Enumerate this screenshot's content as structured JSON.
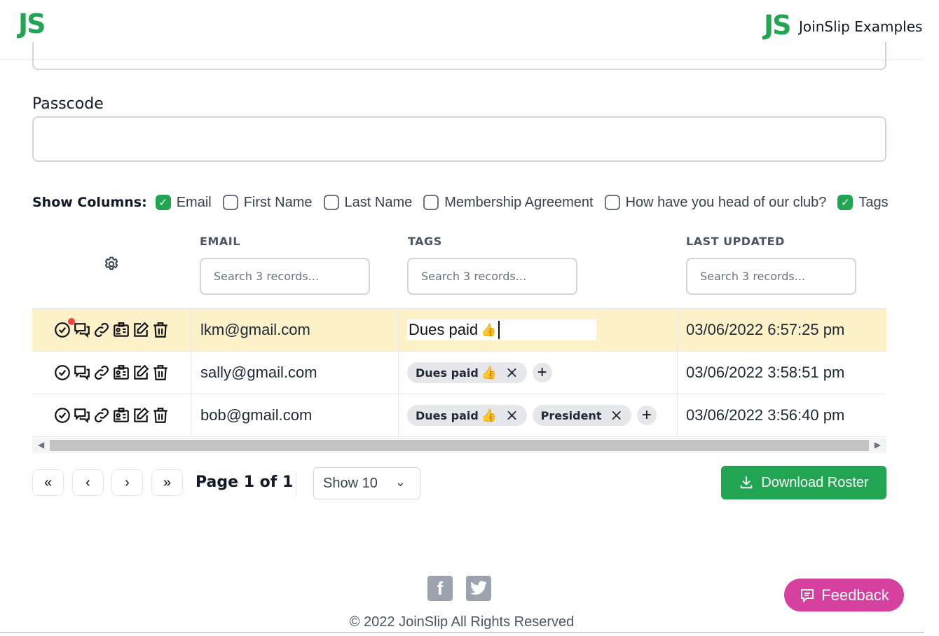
{
  "header": {
    "logo_left": "JS",
    "logo_right": "JS",
    "brand": "JoinSlip Examples"
  },
  "form": {
    "passcode_label": "Passcode",
    "passcode_value": ""
  },
  "show_columns": {
    "label": "Show Columns:",
    "options": [
      {
        "label": "Email",
        "checked": true
      },
      {
        "label": "First Name",
        "checked": false
      },
      {
        "label": "Last Name",
        "checked": false
      },
      {
        "label": "Membership Agreement",
        "checked": false
      },
      {
        "label": "How have you head of our club?",
        "checked": false
      },
      {
        "label": "Tags",
        "checked": true
      }
    ]
  },
  "table": {
    "headers": {
      "email": "EMAIL",
      "tags": "TAGS",
      "last_updated": "LAST UPDATED"
    },
    "search_placeholder": "Search 3 records...",
    "rows": [
      {
        "email": "lkm@gmail.com",
        "tags_editing": "Dues paid",
        "updated": "03/06/2022 6:57:25 pm"
      },
      {
        "email": "sally@gmail.com",
        "tags": [
          "Dues paid"
        ],
        "updated": "03/06/2022 3:58:51 pm"
      },
      {
        "email": "bob@gmail.com",
        "tags": [
          "Dues paid",
          "President"
        ],
        "updated": "03/06/2022 3:56:40 pm"
      }
    ]
  },
  "pagination": {
    "first": "«",
    "prev": "‹",
    "next": "›",
    "last": "»",
    "page_info": "Page 1 of 1",
    "page_size": "Show 10"
  },
  "download_label": "Download Roster",
  "footer": {
    "copyright": "© 2022 JoinSlip All Rights Reserved",
    "feedback": "Feedback"
  },
  "colors": {
    "brand_green": "#22a552",
    "row_highlight": "#fdf1c9",
    "feedback_pink": "#d6409f"
  }
}
